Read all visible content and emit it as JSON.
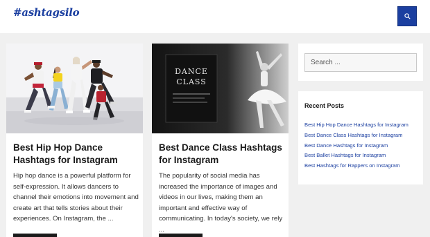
{
  "header": {
    "logo_text": "#ashtagsilo",
    "search_icon": "search-icon"
  },
  "posts": [
    {
      "title": "Best Hip Hop Dance Hashtags for Instagram",
      "excerpt": "Hip hop dance is a powerful platform for self-expression. It allows dancers to channel their emotions into movement and create art that tells stories about their experiences. On Instagram, the ..."
    },
    {
      "title": "Best Dance Class Hashtags for Instagram",
      "excerpt": "The popularity of social media has increased the importance of images and videos in our lives, making them an important and effective way of communicating. In today's society, we rely ...",
      "image_text": [
        "DANCE",
        "CLASS"
      ]
    }
  ],
  "sidebar": {
    "search_placeholder": "Search ...",
    "recent_posts_title": "Recent Posts",
    "recent_posts": [
      "Best Hip Hop Dance Hashtags for Instagram",
      "Best Dance Class Hashtags for Instagram",
      "Best Dance Hashtags for Instagram",
      "Best Ballet Hashtags for Instagram",
      "Best Hashtags for Rappers on Instagram"
    ]
  },
  "colors": {
    "brand": "#1b3fa0",
    "background": "#f0f0f0",
    "text": "#1a1a1a"
  }
}
